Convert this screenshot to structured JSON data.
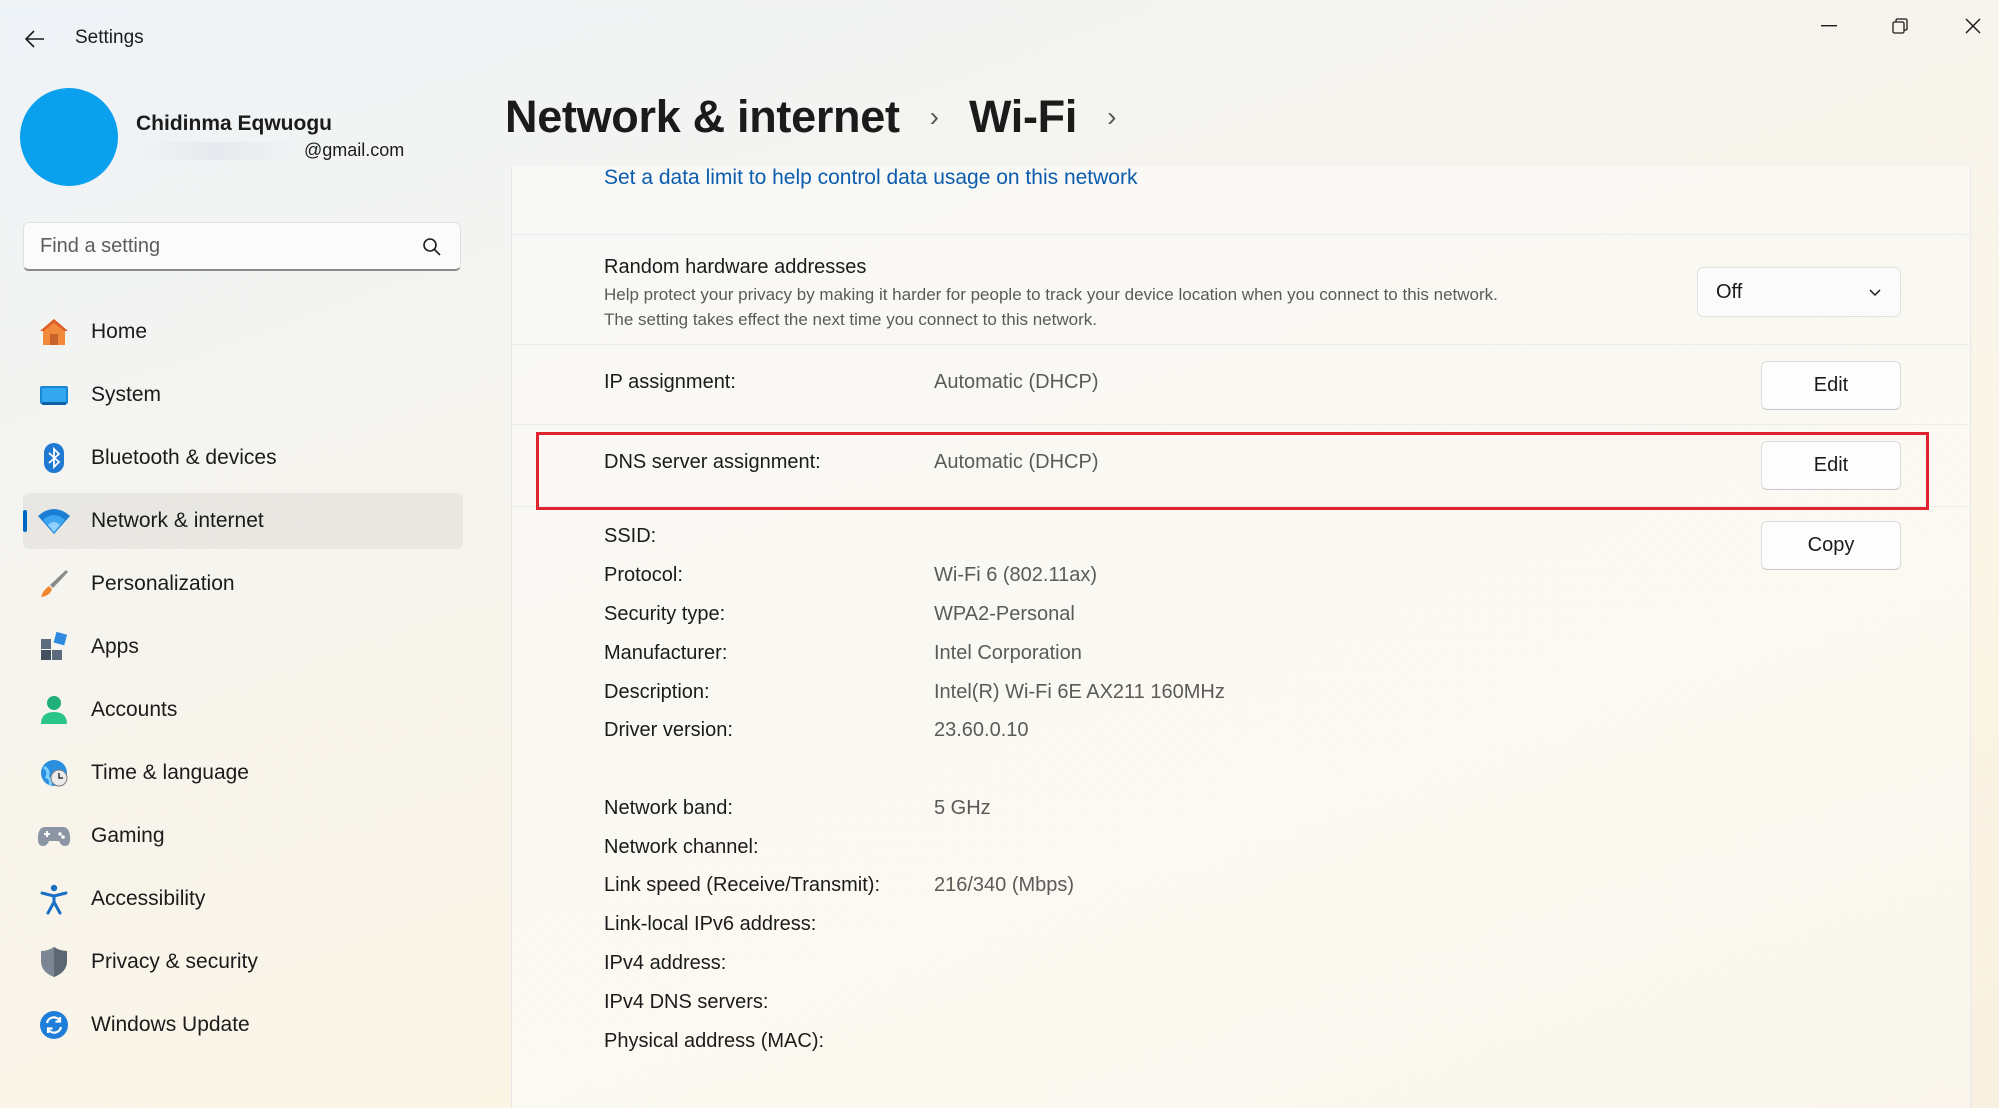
{
  "app": {
    "title": "Settings"
  },
  "window_controls": {
    "minimize_icon": "minimize-icon",
    "restore_icon": "restore-icon",
    "close_icon": "close-icon"
  },
  "profile": {
    "name": "Chidinma Eqwuogu",
    "email_visible": "@gmail.com",
    "avatar_color": "#0aa0ee"
  },
  "search": {
    "placeholder": "Find a setting"
  },
  "nav": {
    "items": [
      {
        "label": "Home",
        "icon": "home-icon",
        "selected": false
      },
      {
        "label": "System",
        "icon": "system-icon",
        "selected": false
      },
      {
        "label": "Bluetooth & devices",
        "icon": "bluetooth-icon",
        "selected": false
      },
      {
        "label": "Network & internet",
        "icon": "wifi-icon",
        "selected": true
      },
      {
        "label": "Personalization",
        "icon": "brush-icon",
        "selected": false
      },
      {
        "label": "Apps",
        "icon": "apps-icon",
        "selected": false
      },
      {
        "label": "Accounts",
        "icon": "accounts-icon",
        "selected": false
      },
      {
        "label": "Time & language",
        "icon": "globe-clock-icon",
        "selected": false
      },
      {
        "label": "Gaming",
        "icon": "gamepad-icon",
        "selected": false
      },
      {
        "label": "Accessibility",
        "icon": "accessibility-icon",
        "selected": false
      },
      {
        "label": "Privacy & security",
        "icon": "shield-icon",
        "selected": false
      },
      {
        "label": "Windows Update",
        "icon": "update-icon",
        "selected": false
      }
    ]
  },
  "breadcrumb": {
    "level1": "Network & internet",
    "level2": "Wi-Fi",
    "separator": "›"
  },
  "main": {
    "data_limit_link": "Set a data limit to help control data usage on this network",
    "random_hw": {
      "title": "Random hardware addresses",
      "description_line1": "Help protect your privacy by making it harder for people to track your device location when you connect to this network.",
      "description_line2": "The setting takes effect the next time you connect to this network.",
      "value": "Off"
    },
    "ip_assignment": {
      "label": "IP assignment:",
      "value": "Automatic (DHCP)",
      "button": "Edit"
    },
    "dns_assignment": {
      "label": "DNS server assignment:",
      "value": "Automatic (DHCP)",
      "button": "Edit"
    },
    "copy_button": "Copy",
    "properties": [
      {
        "label": "SSID:",
        "value": ""
      },
      {
        "label": "Protocol:",
        "value": "Wi-Fi 6 (802.11ax)"
      },
      {
        "label": "Security type:",
        "value": "WPA2-Personal"
      },
      {
        "label": "Manufacturer:",
        "value": "Intel Corporation"
      },
      {
        "label": "Description:",
        "value": "Intel(R) Wi-Fi 6E AX211 160MHz"
      },
      {
        "label": "Driver version:",
        "value": "23.60.0.10"
      },
      {
        "label": "Network band:",
        "value": "5 GHz"
      },
      {
        "label": "Network channel:",
        "value": ""
      },
      {
        "label": "Link speed (Receive/Transmit):",
        "value": "216/340 (Mbps)"
      },
      {
        "label": "Link-local IPv6 address:",
        "value": ""
      },
      {
        "label": "IPv4 address:",
        "value": ""
      },
      {
        "label": "IPv4 DNS servers:",
        "value": ""
      },
      {
        "label": "Physical address (MAC):",
        "value": ""
      }
    ]
  },
  "colors": {
    "accent": "#0067c0",
    "link": "#0b5cad",
    "highlight": "#e0242f"
  }
}
